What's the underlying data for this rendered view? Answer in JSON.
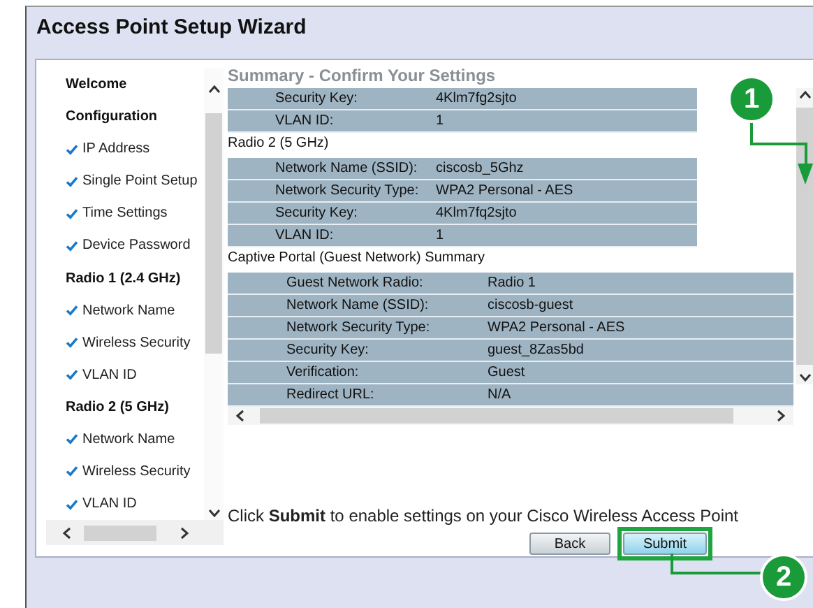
{
  "window": {
    "title": "Access Point Setup Wizard"
  },
  "nav": [
    {
      "label": "Welcome",
      "kind": "heading"
    },
    {
      "label": "Configuration",
      "kind": "heading"
    },
    {
      "label": "IP Address",
      "kind": "step",
      "done": true
    },
    {
      "label": "Single Point Setup",
      "kind": "step",
      "done": true
    },
    {
      "label": "Time Settings",
      "kind": "step",
      "done": true
    },
    {
      "label": "Device Password",
      "kind": "step",
      "done": true
    },
    {
      "label": "Radio 1 (2.4 GHz)",
      "kind": "heading"
    },
    {
      "label": "Network Name",
      "kind": "step",
      "done": true
    },
    {
      "label": "Wireless Security",
      "kind": "step",
      "done": true
    },
    {
      "label": "VLAN ID",
      "kind": "step",
      "done": true
    },
    {
      "label": "Radio 2 (5 GHz)",
      "kind": "heading"
    },
    {
      "label": "Network Name",
      "kind": "step",
      "done": true
    },
    {
      "label": "Wireless Security",
      "kind": "step",
      "done": true
    },
    {
      "label": "VLAN ID",
      "kind": "step",
      "done": true
    }
  ],
  "summary": {
    "heading": "Summary - Confirm Your Settings",
    "sections": [
      {
        "kind": "plain",
        "rows": [
          {
            "label": "Security Key:",
            "value": "4Klm7fg2sjto"
          },
          {
            "label": "VLAN ID:",
            "value": "1"
          }
        ]
      },
      {
        "kind": "plain",
        "title": "Radio 2 (5 GHz)",
        "rows": [
          {
            "label": "Network Name (SSID):",
            "value": "ciscosb_5Ghz"
          },
          {
            "label": "Network Security Type:",
            "value": "WPA2 Personal - AES"
          },
          {
            "label": "Security Key:",
            "value": "4Klm7fq2sjto"
          },
          {
            "label": "VLAN ID:",
            "value": "1"
          }
        ]
      },
      {
        "kind": "scrollable",
        "title": "Captive Portal (Guest Network) Summary",
        "rows": [
          {
            "label": "Guest Network Radio:",
            "value": "Radio 1"
          },
          {
            "label": "Network Name (SSID):",
            "value": "ciscosb-guest"
          },
          {
            "label": "Network Security Type:",
            "value": "WPA2 Personal - AES"
          },
          {
            "label": "Security Key:",
            "value": "guest_8Zas5bd"
          },
          {
            "label": "Verification:",
            "value": "Guest"
          },
          {
            "label": "Redirect URL:",
            "value": "N/A"
          }
        ]
      }
    ]
  },
  "message": "Click **Submit** to enable settings on your Cisco Wireless Access Point",
  "buttons": [
    {
      "label": "Back",
      "kind": "default",
      "highlighted": false
    },
    {
      "label": "Submit",
      "kind": "primary",
      "highlighted": true
    }
  ],
  "callouts": [
    {
      "label": "1"
    },
    {
      "label": "2"
    }
  ]
}
